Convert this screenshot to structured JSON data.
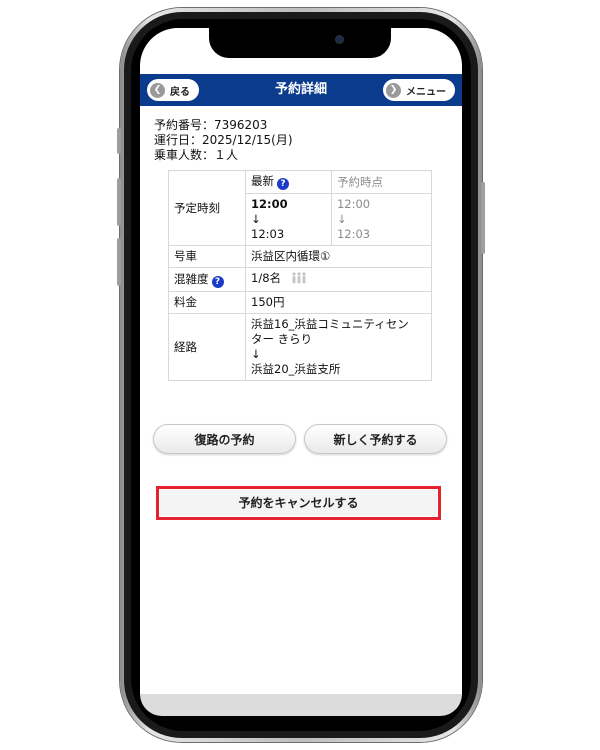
{
  "header": {
    "title": "予約詳細",
    "back_label": "戻る",
    "menu_label": "メニュー"
  },
  "reservation": {
    "number_line": "予約番号：7396203",
    "date_line": "運行日：2025/12/15(月)",
    "passengers_line": "乗車人数：１人"
  },
  "table": {
    "col_latest": "最新",
    "col_at_booking": "予約時点",
    "rows": {
      "scheduled_time": {
        "label": "予定時刻",
        "latest_from": "12:00",
        "latest_arrow": "↓",
        "latest_to": "12:03",
        "booking_from": "12:00",
        "booking_arrow": "↓",
        "booking_to": "12:03"
      },
      "vehicle": {
        "label": "号車",
        "value": "浜益区内循環①"
      },
      "congestion": {
        "label": "混雑度",
        "value": "1/8名"
      },
      "fare": {
        "label": "料金",
        "value": "150円"
      },
      "route": {
        "label": "経路",
        "from_line1": "浜益16_浜益コミュニティセン",
        "from_line2": "ター きらり",
        "arrow": "↓",
        "to": "浜益20_浜益支所"
      }
    }
  },
  "buttons": {
    "return_trip": "復路の予約",
    "new_reservation": "新しく予約する",
    "cancel": "予約をキャンセルする"
  },
  "icons": {
    "back": "arrow-left-circle-icon",
    "menu": "arrow-right-circle-icon",
    "help": "question-mark-icon",
    "people": "people-icon"
  },
  "colors": {
    "header_bg": "#0b3b8c",
    "help_icon": "#1a3cc9",
    "highlight_border": "#e5232e"
  }
}
